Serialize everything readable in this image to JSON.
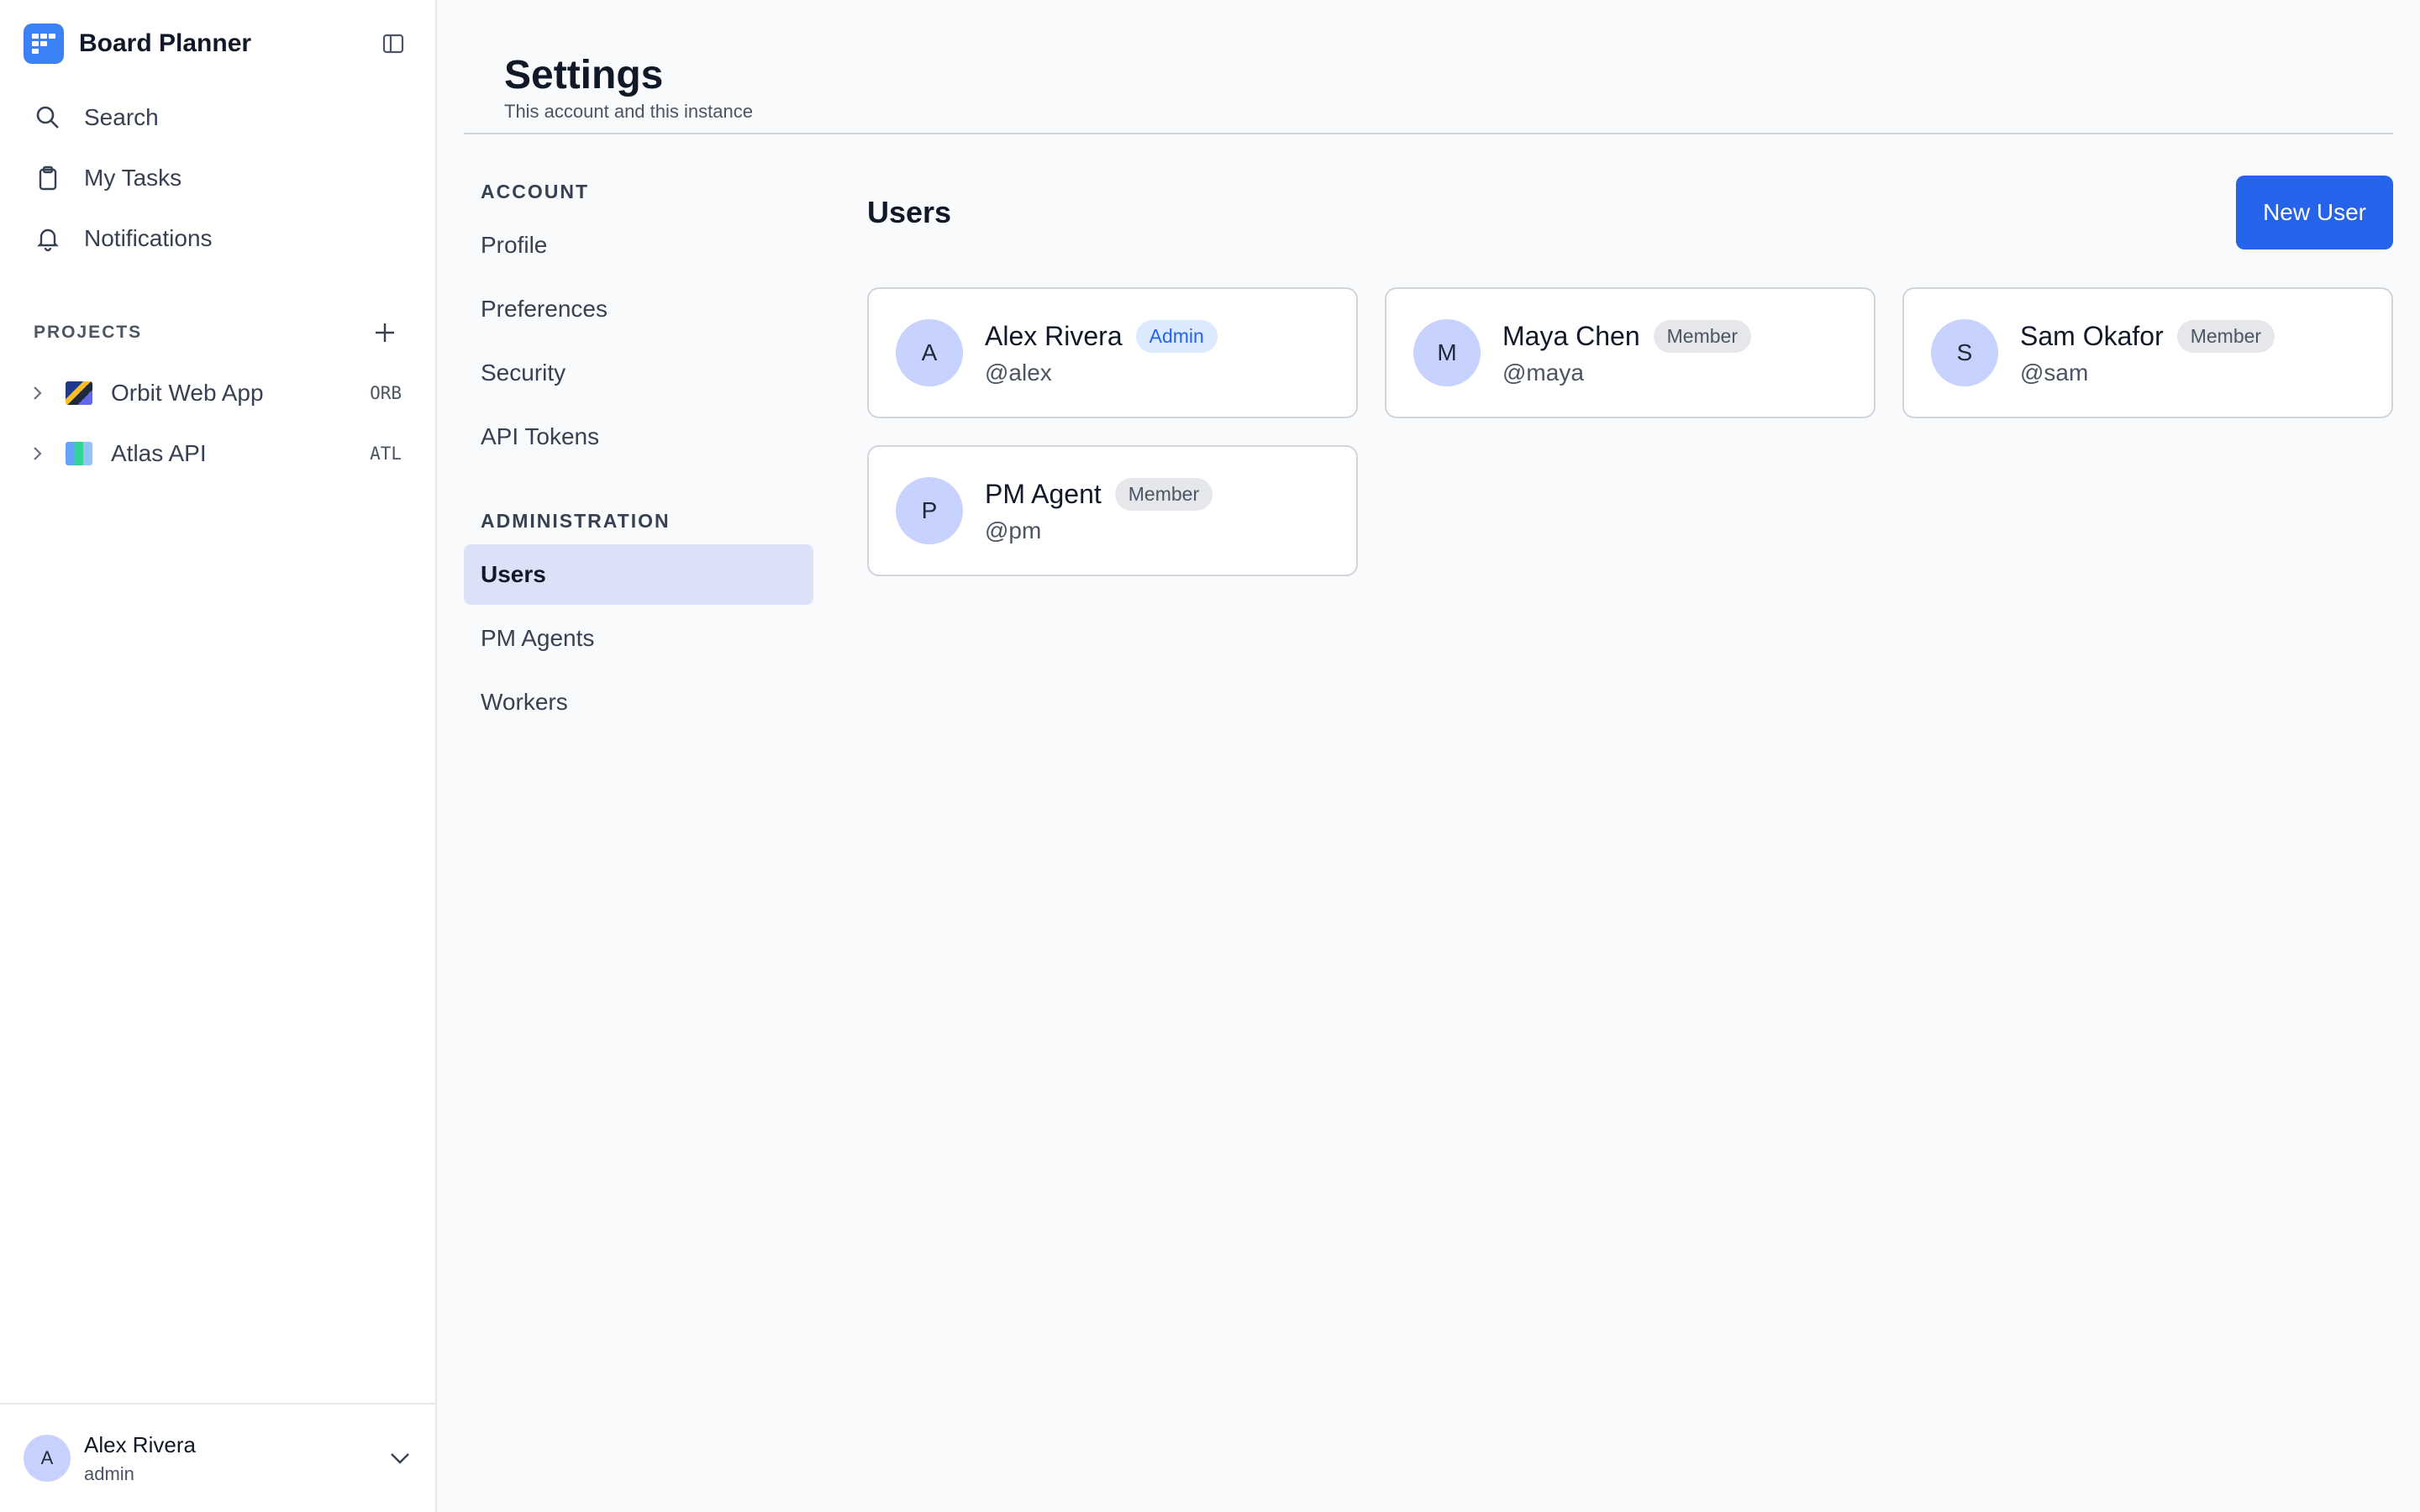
{
  "app": {
    "name": "Board Planner"
  },
  "nav": [
    {
      "label": "Search",
      "icon": "search-icon"
    },
    {
      "label": "My Tasks",
      "icon": "clipboard-icon"
    },
    {
      "label": "Notifications",
      "icon": "bell-icon"
    }
  ],
  "projects": {
    "title": "PROJECTS",
    "items": [
      {
        "name": "Orbit Web App",
        "code": "ORB"
      },
      {
        "name": "Atlas API",
        "code": "ATL"
      }
    ]
  },
  "current_user": {
    "initial": "A",
    "name": "Alex Rivera",
    "role": "admin"
  },
  "page": {
    "title": "Settings",
    "subtitle": "This account and this instance"
  },
  "settings_nav": {
    "account_title": "ACCOUNT",
    "account_items": [
      "Profile",
      "Preferences",
      "Security",
      "API Tokens"
    ],
    "admin_title": "ADMINISTRATION",
    "admin_items": [
      "Users",
      "PM Agents",
      "Workers"
    ],
    "active": "Users"
  },
  "users_panel": {
    "title": "Users",
    "new_button": "New User",
    "users": [
      {
        "initial": "A",
        "name": "Alex Rivera",
        "badge": "Admin",
        "handle": "@alex"
      },
      {
        "initial": "M",
        "name": "Maya Chen",
        "badge": "Member",
        "handle": "@maya"
      },
      {
        "initial": "S",
        "name": "Sam Okafor",
        "badge": "Member",
        "handle": "@sam"
      },
      {
        "initial": "P",
        "name": "PM Agent",
        "badge": "Member",
        "handle": "@pm"
      }
    ]
  },
  "colors": {
    "accent": "#2563eb",
    "brand": "#3b82f6",
    "avatar": "#c7d2fe",
    "active_nav": "#dbe2f7"
  }
}
